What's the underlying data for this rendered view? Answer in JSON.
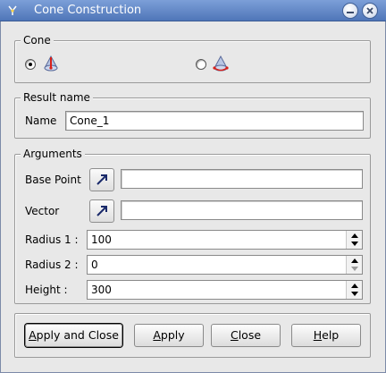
{
  "window": {
    "title": "Cone Construction",
    "app_icon": "geometry-icon",
    "controls": [
      "minimize-icon",
      "close-icon"
    ]
  },
  "cone_group": {
    "legend": "Cone",
    "options": [
      {
        "icon": "cone-by-point-vector-icon",
        "selected": true
      },
      {
        "icon": "cone-by-plane-icon",
        "selected": false
      }
    ]
  },
  "result_group": {
    "legend": "Result name",
    "name_label": "Name",
    "name_value": "Cone_1"
  },
  "arguments_group": {
    "legend": "Arguments",
    "base_point_label": "Base Point",
    "base_point_value": "",
    "vector_label": "Vector",
    "vector_value": "",
    "select_icon": "select-arrow-icon",
    "radius1_label": "Radius 1 :",
    "radius1_value": "100",
    "radius2_label": "Radius 2 :",
    "radius2_value": "0",
    "height_label": "Height :",
    "height_value": "300"
  },
  "buttons": {
    "apply_close": {
      "pre": "",
      "u": "A",
      "post": "pply and Close"
    },
    "apply": {
      "pre": "",
      "u": "A",
      "post": "pply"
    },
    "close": {
      "pre": "",
      "u": "C",
      "post": "lose"
    },
    "help": {
      "pre": "",
      "u": "H",
      "post": "elp"
    }
  },
  "colors": {
    "titlebar": "#5a80c0",
    "background": "#e8e8e8",
    "cone_red": "#d8201a"
  }
}
